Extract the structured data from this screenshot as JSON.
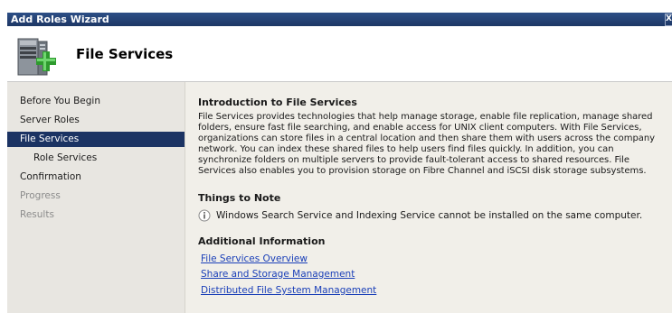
{
  "window": {
    "title": "Add Roles Wizard",
    "close_label": "X"
  },
  "header": {
    "title": "File Services",
    "icon": "server-add-icon"
  },
  "nav": {
    "items": [
      {
        "label": "Before You Begin",
        "state": "normal"
      },
      {
        "label": "Server Roles",
        "state": "normal"
      },
      {
        "label": "File Services",
        "state": "selected"
      },
      {
        "label": "Role Services",
        "state": "normal"
      },
      {
        "label": "Confirmation",
        "state": "normal"
      },
      {
        "label": "Progress",
        "state": "disabled"
      },
      {
        "label": "Results",
        "state": "disabled"
      }
    ]
  },
  "content": {
    "intro_heading": "Introduction to File Services",
    "intro_text": "File Services provides technologies that help manage storage, enable file replication, manage shared folders, ensure fast file searching, and enable access for UNIX client computers. With File Services, organizations can store files in a central location and then share them with users across the company network. You can index these shared files to help users find files quickly. In addition, you can synchronize folders on multiple servers to provide fault-tolerant access to shared resources. File Services also enables you to provision storage on Fibre Channel and iSCSI disk storage subsystems.",
    "notes_heading": "Things to Note",
    "note_text": "Windows Search Service and Indexing Service cannot be installed on the same computer.",
    "note_icon": "info-icon",
    "additional_heading": "Additional Information",
    "links": [
      "File Services Overview",
      "Share and Storage Management",
      "Distributed File System Management"
    ]
  },
  "colors": {
    "title_bar": "#2d4f86",
    "nav_selected": "#1b3363",
    "nav_background": "#e8e6e1",
    "content_background": "#f1efe9",
    "link": "#1a3fb8"
  }
}
